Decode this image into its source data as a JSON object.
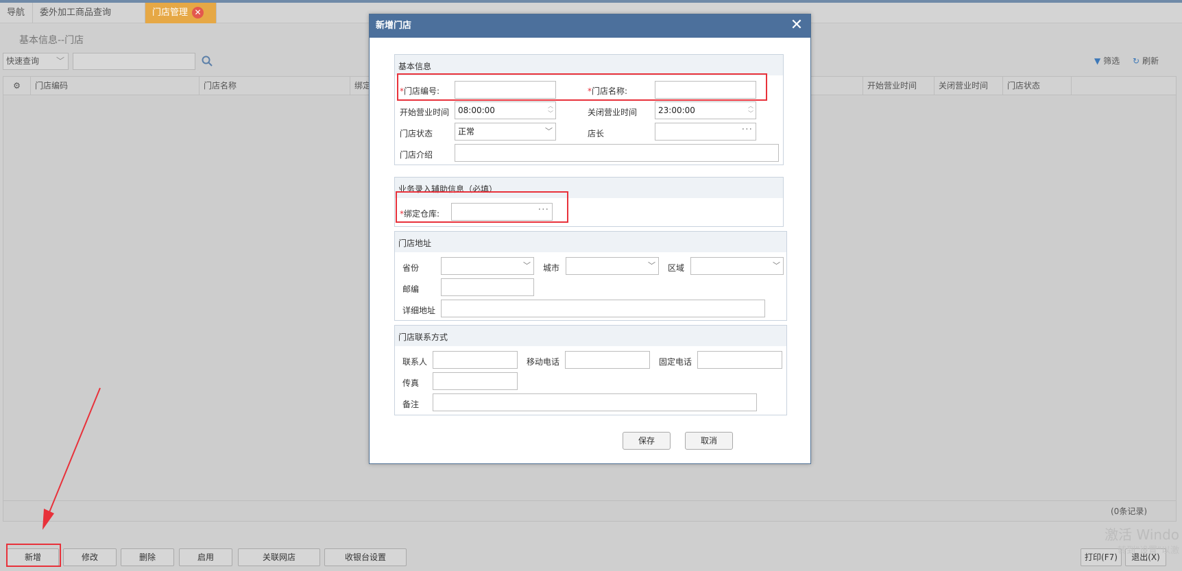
{
  "tabs": {
    "nav": "导航",
    "outsourcing": "委外加工商品查询",
    "store_mgmt": "门店管理",
    "close_glyph": "✕"
  },
  "breadcrumb": "基本信息--门店",
  "quick_query": {
    "select": "快速查询",
    "chevron": "﹀"
  },
  "toolbar": {
    "filter": "筛选",
    "refresh": "刷新"
  },
  "grid": {
    "columns": [
      "门店编码",
      "门店名称",
      "绑定",
      "开始营业时间",
      "关闭营业时间",
      "门店状态"
    ],
    "record_count": "(0条记录)"
  },
  "bottom_buttons": {
    "add": "新增",
    "edit": "修改",
    "delete": "删除",
    "enable": "启用",
    "link_online": "关联网店",
    "cashier": "收银台设置",
    "print": "打印(F7)",
    "exit": "退出(X)"
  },
  "watermark": {
    "line1": "激活 Windo",
    "line2": "转到\"设置\"以激"
  },
  "dialog": {
    "title": "新增门店",
    "close": "✕",
    "basic": {
      "header": "基本信息",
      "required_mark": "*",
      "store_code_label": "门店编号:",
      "store_name_label": "门店名称:",
      "open_time_label": "开始营业时间",
      "open_time_value": "08:00:00",
      "close_time_label": "关闭营业时间",
      "close_time_value": "23:00:00",
      "status_label": "门店状态",
      "status_value": "正常",
      "manager_label": "店长",
      "intro_label": "门店介绍"
    },
    "business": {
      "header": "业务录入辅助信息（必填）",
      "warehouse_label": "绑定仓库:"
    },
    "address": {
      "header": "门店地址",
      "province_label": "省份",
      "city_label": "城市",
      "district_label": "区域",
      "postcode_label": "邮编",
      "detail_label": "详细地址"
    },
    "contact": {
      "header": "门店联系方式",
      "contact_label": "联系人",
      "mobile_label": "移动电话",
      "phone_label": "固定电话",
      "fax_label": "传真",
      "remark_label": "备注"
    },
    "save": "保存",
    "cancel": "取消"
  }
}
